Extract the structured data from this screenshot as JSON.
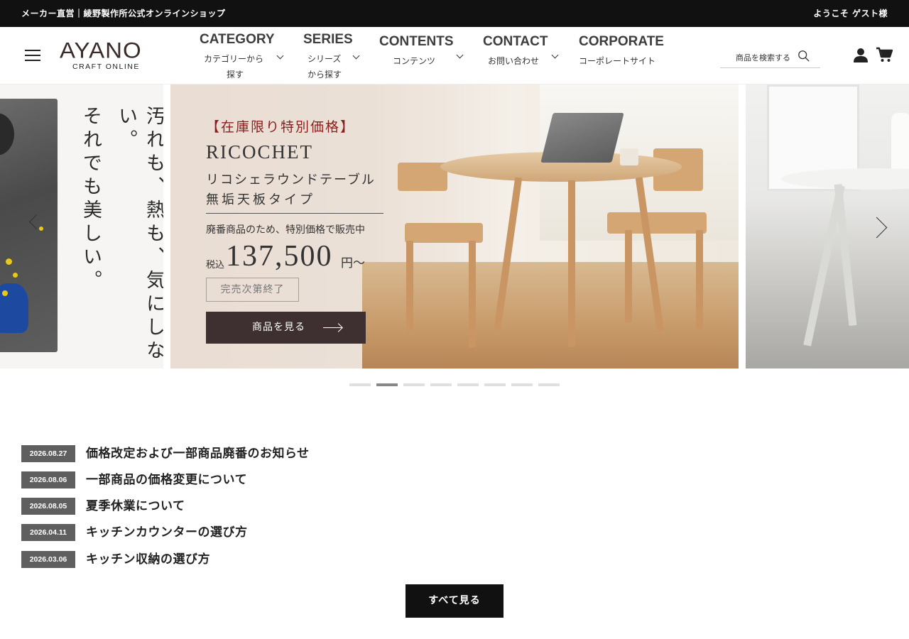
{
  "topbar": {
    "shop_name": "メーカー直営｜綾野製作所公式オンラインショップ",
    "welcome": "ようこそ ゲスト様"
  },
  "header": {
    "logo": {
      "wordmark": "AYANO",
      "subtitle": "CRAFT ONLINE"
    },
    "nav": [
      {
        "en": "CATEGORY",
        "jp_lines": [
          "カテゴリーから",
          "探す"
        ]
      },
      {
        "en": "SERIES",
        "jp_lines": [
          "シリーズ",
          "から探す"
        ]
      },
      {
        "en": "CONTENTS",
        "jp_lines": [
          "コンテンツ"
        ]
      },
      {
        "en": "CONTACT",
        "jp_lines": [
          "お問い合わせ"
        ]
      },
      {
        "en": "CORPORATE",
        "jp_lines": [
          "コーポレートサイト"
        ]
      }
    ],
    "search": {
      "placeholder": "商品を検索する"
    },
    "icons": [
      "menu-icon",
      "search-icon",
      "user-icon",
      "cart-icon"
    ]
  },
  "carousel": {
    "prev_slide_text": [
      "汚れも、熱も、気にしない。",
      "それでも美しい。"
    ],
    "main_slide": {
      "tag": "【在庫限り特別価格】",
      "brand": "RICOCHET",
      "name_line1": "リコシェラウンドテーブル",
      "name_line2": "無垢天板タイプ",
      "note": "廃番商品のため、特別価格で販売中",
      "tax_label": "税込",
      "price": "137,500",
      "price_suffix": "円～",
      "badge": "完売次第終了",
      "cta": "商品を見る"
    },
    "slide_count": 8,
    "active_index": 1
  },
  "news": [
    {
      "date": "2026.08.27",
      "title": "価格改定および一部商品廃番のお知らせ"
    },
    {
      "date": "2026.08.06",
      "title": "一部商品の価格変更について"
    },
    {
      "date": "2026.08.05",
      "title": "夏季休業について"
    },
    {
      "date": "2026.04.11",
      "title": "キッチンカウンターの選び方"
    },
    {
      "date": "2026.03.06",
      "title": "キッチン収納の選び方"
    }
  ],
  "more_button": "すべて見る",
  "colors": {
    "topbar": "#111111",
    "cta": "#3e2f31",
    "tag_red": "#8a1e1e",
    "date_badge": "#5f5f5f"
  }
}
